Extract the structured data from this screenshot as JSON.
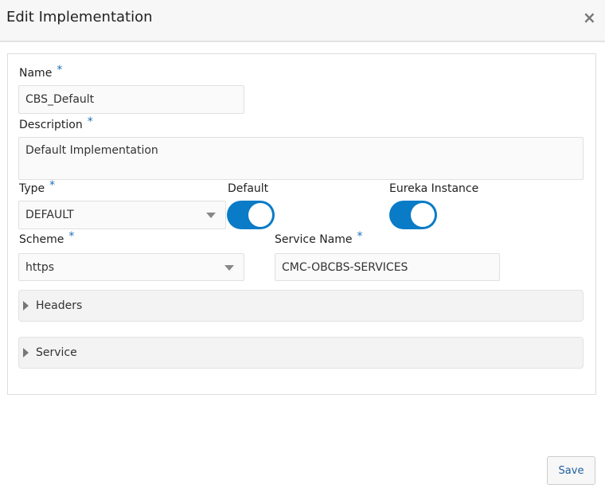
{
  "dialog": {
    "title": "Edit Implementation",
    "close_icon": "×"
  },
  "form": {
    "name": {
      "label": "Name",
      "required": "*",
      "value": "CBS_Default"
    },
    "description": {
      "label": "Description",
      "required": "*",
      "value": "Default Implementation"
    },
    "type": {
      "label": "Type",
      "required": "*",
      "value": "DEFAULT"
    },
    "default": {
      "label": "Default",
      "on": true
    },
    "eureka": {
      "label": "Eureka Instance",
      "on": true
    },
    "scheme": {
      "label": "Scheme",
      "required": "*",
      "value": "https"
    },
    "service_name": {
      "label": "Service Name",
      "required": "*",
      "value": "CMC-OBCBS-SERVICES"
    },
    "sections": [
      {
        "label": "Headers"
      },
      {
        "label": "Service"
      }
    ]
  },
  "footer": {
    "save_label": "Save"
  },
  "colors": {
    "accent": "#0a7bc7"
  }
}
